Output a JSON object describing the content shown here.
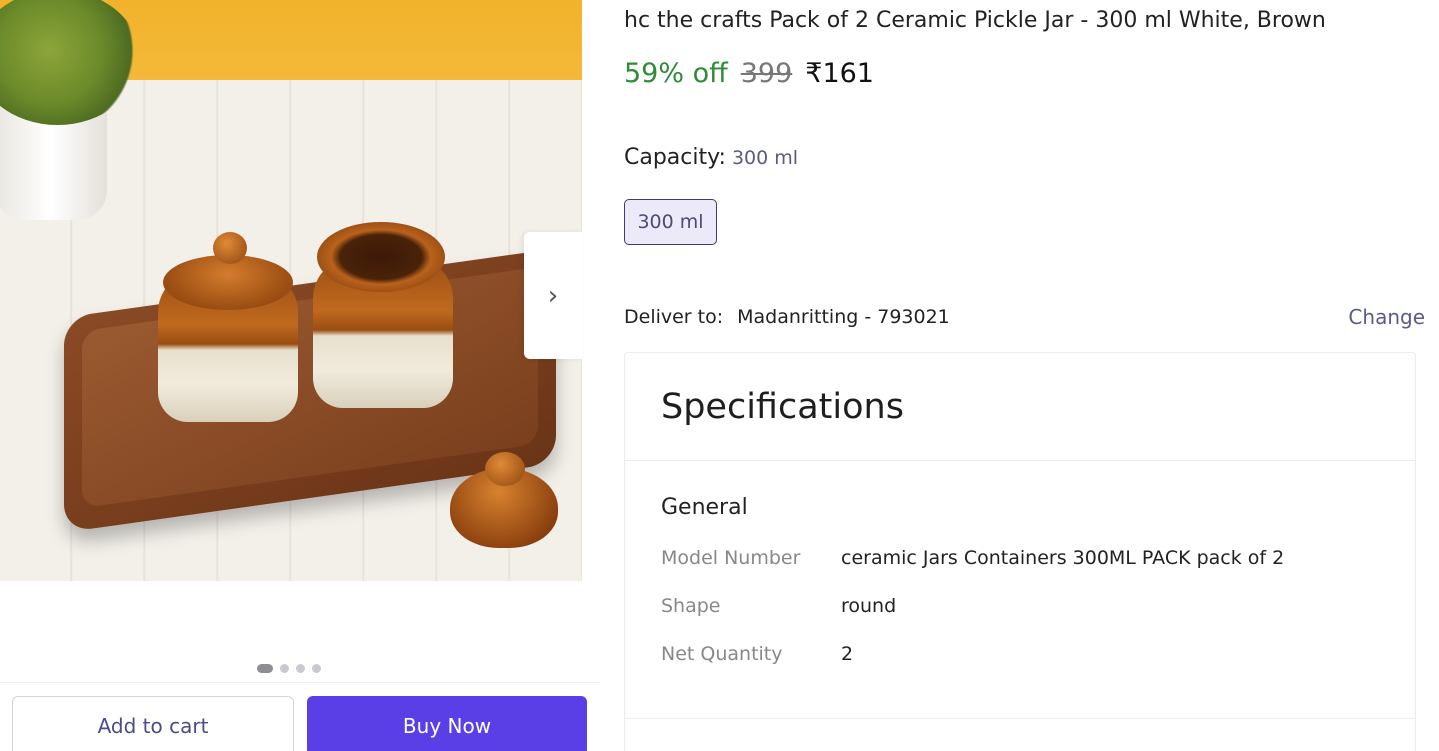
{
  "product": {
    "title": "hc the crafts Pack of 2 Ceramic Pickle Jar  - 300 ml White, Brown",
    "discount": "59% off",
    "mrp": "399",
    "price": "₹161"
  },
  "capacity": {
    "label": "Capacity:",
    "selected": "300 ml",
    "options": [
      "300 ml"
    ]
  },
  "delivery": {
    "label": "Deliver to:",
    "address": "Madanritting - 793021",
    "change_label": "Change"
  },
  "specifications": {
    "title": "Specifications",
    "group": "General",
    "rows": [
      {
        "key": "Model Number",
        "value": "ceramic Jars Containers 300ML PACK pack of 2"
      },
      {
        "key": "Shape",
        "value": "round"
      },
      {
        "key": "Net Quantity",
        "value": "2"
      }
    ]
  },
  "gallery": {
    "next_icon": "chevron-right-icon",
    "dots": 4,
    "active_dot": 0
  },
  "actions": {
    "add_to_cart": "Add to cart",
    "buy_now": "Buy Now"
  },
  "colors": {
    "accent": "#5a3fe6",
    "discount": "#2e8b38",
    "link": "#5a5a8c"
  }
}
